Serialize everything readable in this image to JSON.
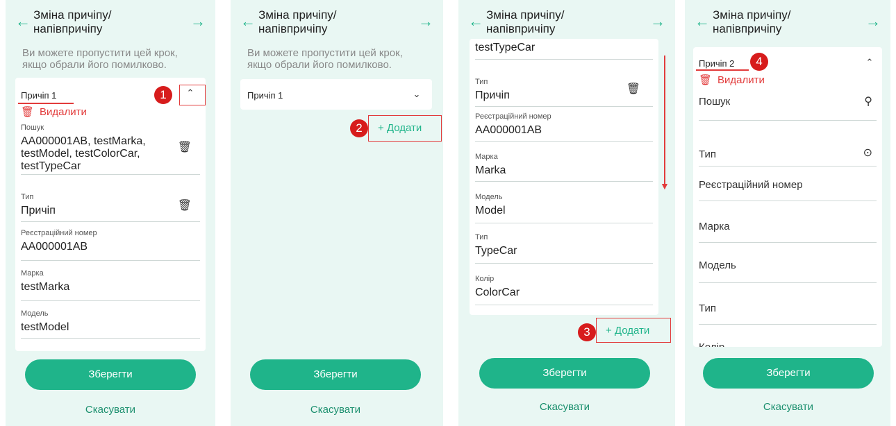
{
  "header_title": "Зміна причіпу/ напівпричіпу",
  "hint": "Ви можете пропустити цей крок, якщо обрали його помилково.",
  "save_label": "Зберегти",
  "cancel_label": "Скасувати",
  "add_label": "+ Додати",
  "delete_label": "Видалити",
  "panel1": {
    "section_title": "Причіп 1",
    "fields": [
      {
        "label": "Пошук",
        "value": "AA000001AB, testMarka, testModel, testColorCar, testTypeCar"
      },
      {
        "label": "Тип",
        "value": "Причіп"
      },
      {
        "label": "Реєстраційний номер",
        "value": "AA000001AB"
      },
      {
        "label": "Марка",
        "value": "testMarka"
      },
      {
        "label": "Модель",
        "value": "testModel"
      }
    ]
  },
  "panel2": {
    "section_title": "Причіп 1"
  },
  "panel3": {
    "top_cut_value": "testTypeCar",
    "fields": [
      {
        "label": "Тип",
        "value": "Причіп"
      },
      {
        "label": "Реєстраційний номер",
        "value": "AA000001AB"
      },
      {
        "label": "Марка",
        "value": "Marka"
      },
      {
        "label": "Модель",
        "value": "Model"
      },
      {
        "label": "Тип",
        "value": "TypeCar"
      },
      {
        "label": "Колір",
        "value": "ColorCar"
      }
    ]
  },
  "panel4": {
    "section_title": "Причіп 2",
    "fields": [
      "Пошук",
      "Тип",
      "Реєстраційний номер",
      "Марка",
      "Модель",
      "Тип",
      "Колір"
    ]
  },
  "markers": [
    "1",
    "2",
    "3",
    "4"
  ],
  "icons": {
    "back": "arrow-left-icon",
    "forward": "arrow-right-icon",
    "trash": "trash-icon",
    "chevron_up": "chevron-up-icon",
    "chevron_down": "chevron-down-icon",
    "search": "search-icon",
    "dropdown": "dropdown-circle-icon"
  },
  "colors": {
    "accent": "#1fb48a",
    "danger": "#e23b3b",
    "background": "#e9f7f3",
    "marker": "#d71c1c"
  }
}
